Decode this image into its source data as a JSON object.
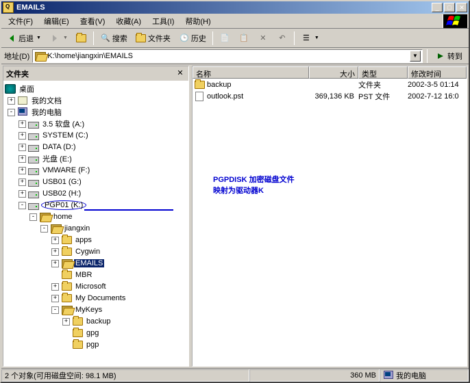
{
  "titlebar": {
    "title": "EMAILS"
  },
  "menubar": {
    "file": "文件(F)",
    "edit": "编辑(E)",
    "view": "查看(V)",
    "fav": "收藏(A)",
    "tools": "工具(I)",
    "help": "帮助(H)"
  },
  "toolbar": {
    "back": "后退",
    "search": "搜索",
    "folders": "文件夹",
    "history": "历史"
  },
  "addressbar": {
    "label": "地址(D)",
    "path": "K:\\home\\jiangxin\\EMAILS",
    "go": "转到"
  },
  "left_pane": {
    "title": "文件夹"
  },
  "tree": {
    "desktop": "桌面",
    "my_docs": "我的文档",
    "my_comp": "我的电脑",
    "drives": {
      "a": "3.5 软盘 (A:)",
      "c": "SYSTEM (C:)",
      "d": "DATA (D:)",
      "e": "光盘 (E:)",
      "f": "VMWARE (F:)",
      "g": "USB01 (G:)",
      "h": "USB02 (H:)",
      "k": "PGP01 (K:)"
    },
    "k": {
      "home": "home",
      "jiangxin": "jiangxin",
      "apps": "apps",
      "cygwin": "Cygwin",
      "emails": "EMAILS",
      "mbr": "MBR",
      "microsoft": "Microsoft",
      "mydocs": "My Documents",
      "mykeys": "MyKeys",
      "backup": "backup",
      "gpg": "gpg",
      "pgp": "pgp"
    }
  },
  "columns": {
    "name": "名称",
    "size": "大小",
    "type": "类型",
    "date": "修改时间"
  },
  "files": [
    {
      "name": "backup",
      "size": "",
      "type": "文件夹",
      "date": "2002-3-5 01:14",
      "icon": "folder"
    },
    {
      "name": "outlook.pst",
      "size": "369,136 KB",
      "type": "PST 文件",
      "date": "2002-7-12 16:0",
      "icon": "file"
    }
  ],
  "annotation": {
    "line1": "PGPDISK 加密磁盘文件",
    "line2": "映射为驱动器K"
  },
  "statusbar": {
    "left": "2 个对象(可用磁盘空间: 98.1 MB)",
    "mid": "360 MB",
    "right": "我的电脑"
  }
}
